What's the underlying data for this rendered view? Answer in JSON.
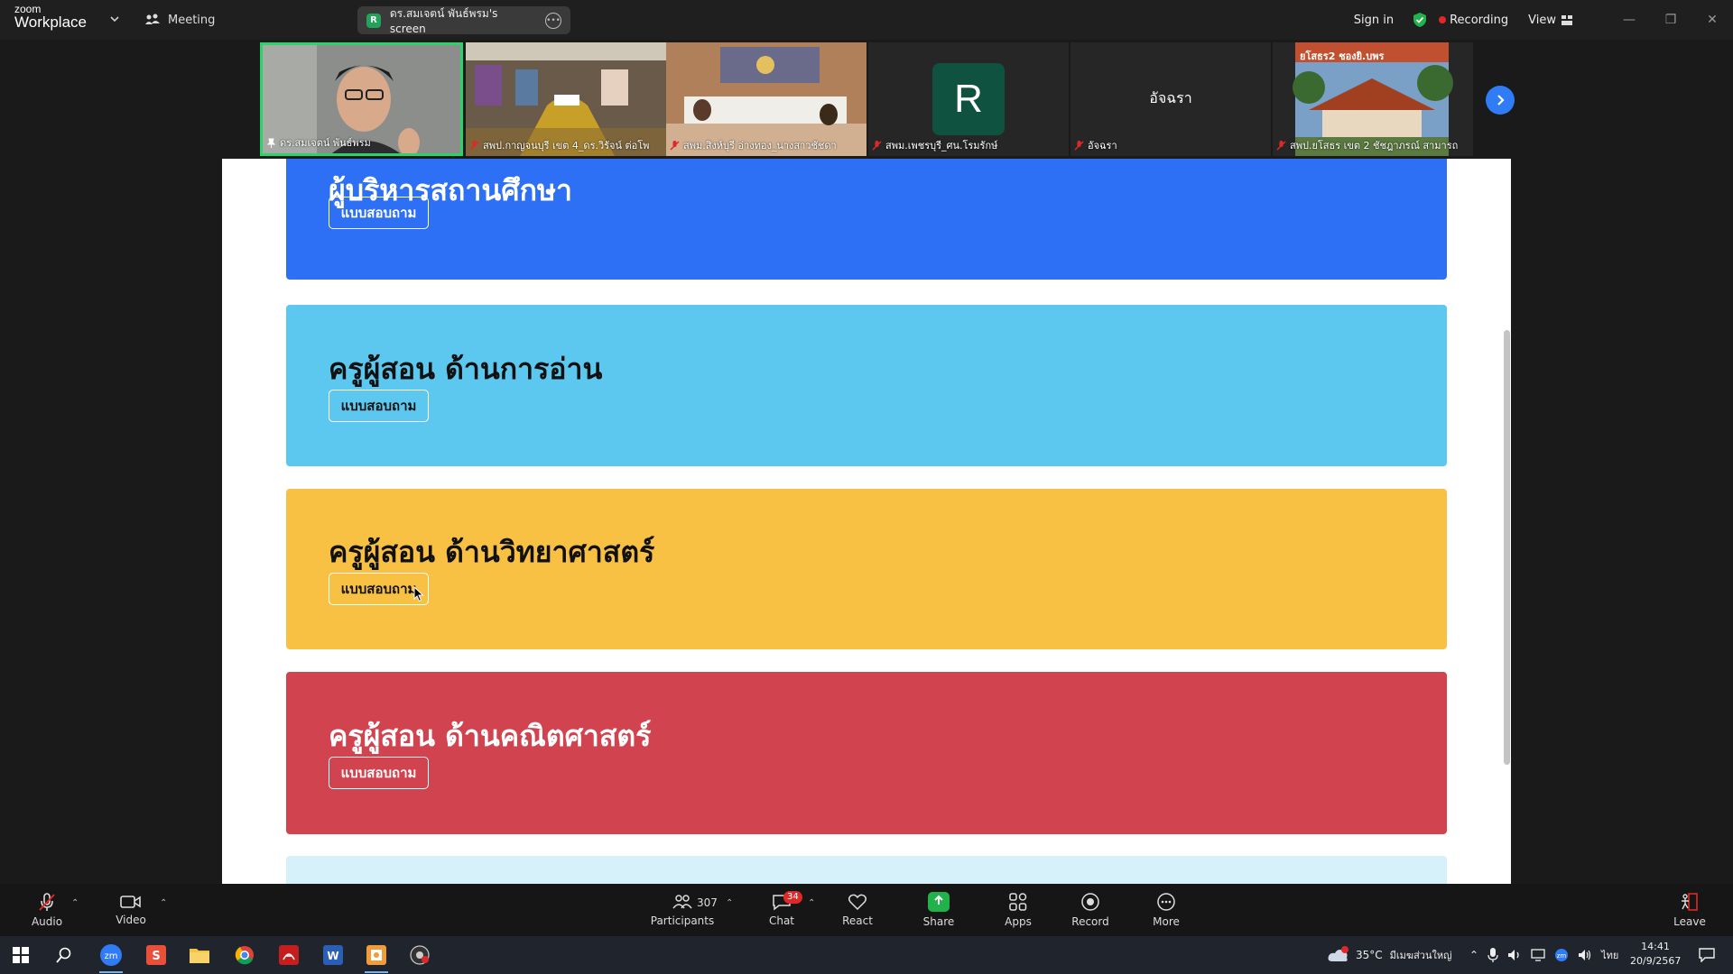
{
  "app": {
    "logo_line1": "zoom",
    "logo_line2": "Workplace",
    "meeting_label": "Meeting",
    "screen_tab_label": "ดร.สมเจตน์ พันธ์พรม's screen",
    "screen_tab_initial": "R",
    "signin_label": "Sign in",
    "recording_label": "Recording",
    "view_label": "View"
  },
  "participants_strip": [
    {
      "name": "ดร.สมเจตน์ พันธ์พรม",
      "type": "video",
      "active": true
    },
    {
      "name": "สพป.กาญจนบุรี เขต 4_ดร.วิรัจน์ ต่อโพ",
      "type": "video",
      "active": false
    },
    {
      "name": "สพม.สิงห์บุรี อ่างทอง_นางสาวชัชดา",
      "type": "video",
      "active": false
    },
    {
      "name": "สพม.เพชรบุรี_ศน.โรมรักษ์",
      "type": "avatar",
      "initial": "R"
    },
    {
      "name": "อัจฉรา",
      "type": "name-only",
      "display_name": "อัจฉรา"
    },
    {
      "name": "สพป.ยโสธร เขต 2 ชัชฎาภรณ์ สามารถ",
      "type": "video",
      "active": false,
      "overlay_text": "ยโสธร2 ชองยิ.บพร"
    }
  ],
  "shared_screen": {
    "cards": [
      {
        "title": "ผู้บริหารสถานศึกษา",
        "button": "แบบสอบถาม",
        "color": "#2d6ff5",
        "text_color": "#ffffff"
      },
      {
        "title": "ครูผู้สอน ด้านการอ่าน",
        "button": "แบบสอบถาม",
        "color": "#5cc8ef",
        "text_color": "#111111"
      },
      {
        "title": "ครูผู้สอน ด้านวิทยาศาสตร์",
        "button": "แบบสอบถาม",
        "color": "#f8c144",
        "text_color": "#111111"
      },
      {
        "title": "ครูผู้สอน ด้านคณิตศาสตร์",
        "button": "แบบสอบถาม",
        "color": "#d0434f",
        "text_color": "#ffffff"
      },
      {
        "title": "",
        "button": "",
        "color": "#d7f1fb",
        "text_color": "#111111"
      }
    ]
  },
  "toolbar": {
    "audio_label": "Audio",
    "video_label": "Video",
    "participants_label": "Participants",
    "participants_count": "307",
    "chat_label": "Chat",
    "chat_badge": "34",
    "react_label": "React",
    "share_label": "Share",
    "apps_label": "Apps",
    "record_label": "Record",
    "more_label": "More",
    "leave_label": "Leave"
  },
  "taskbar": {
    "weather_temp": "35°C",
    "weather_text": "มีเมฆส่วนใหญ่",
    "language": "ไทย",
    "time": "14:41",
    "date": "20/9/2567"
  },
  "colors": {
    "accent_green": "#2bd46b",
    "record_red": "#e02828",
    "share_green": "#22b24c",
    "zoom_blue": "#2f7cf6"
  }
}
